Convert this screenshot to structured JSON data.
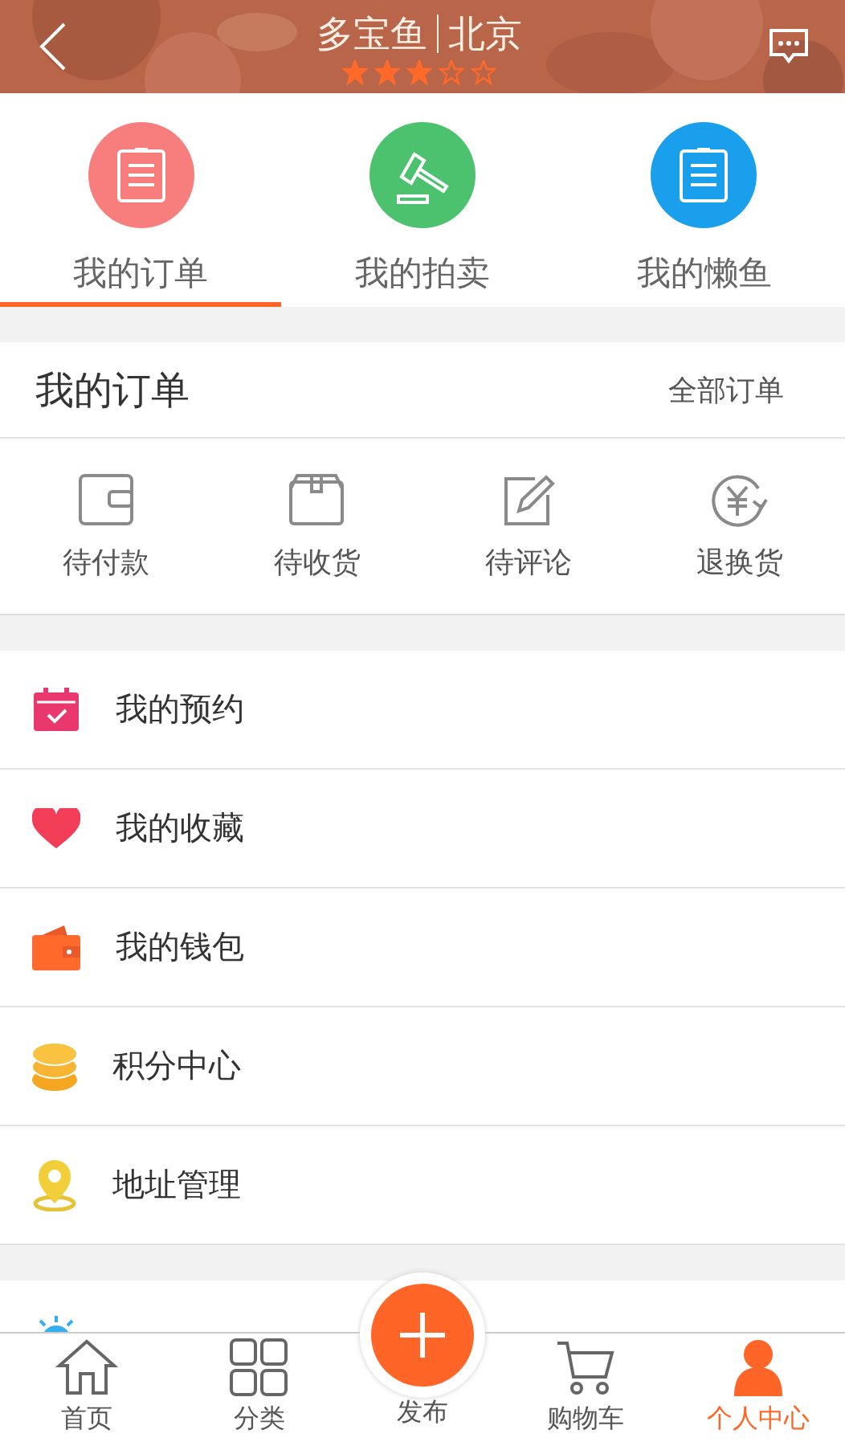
{
  "header": {
    "shop_name": "多宝鱼",
    "city": "北京",
    "stars": 3
  },
  "top_tabs": [
    {
      "label": "我的订单",
      "color": "#f87e7e",
      "selected": true
    },
    {
      "label": "我的拍卖",
      "color": "#4cc26f",
      "selected": false
    },
    {
      "label": "我的懒鱼",
      "color": "#1a9fec",
      "selected": false
    }
  ],
  "orders": {
    "title": "我的订单",
    "all_link": "全部订单",
    "statuses": [
      {
        "label": "待付款"
      },
      {
        "label": "待收货"
      },
      {
        "label": "待评论"
      },
      {
        "label": "退换货"
      }
    ]
  },
  "menu": [
    {
      "label": "我的预约"
    },
    {
      "label": "我的收藏"
    },
    {
      "label": "我的钱包"
    },
    {
      "label": "积分中心"
    },
    {
      "label": "地址管理"
    }
  ],
  "bottom_nav": [
    {
      "label": "首页",
      "selected": false
    },
    {
      "label": "分类",
      "selected": false
    },
    {
      "label": "发布",
      "selected": false
    },
    {
      "label": "购物车",
      "selected": false
    },
    {
      "label": "个人中心",
      "selected": true
    }
  ]
}
